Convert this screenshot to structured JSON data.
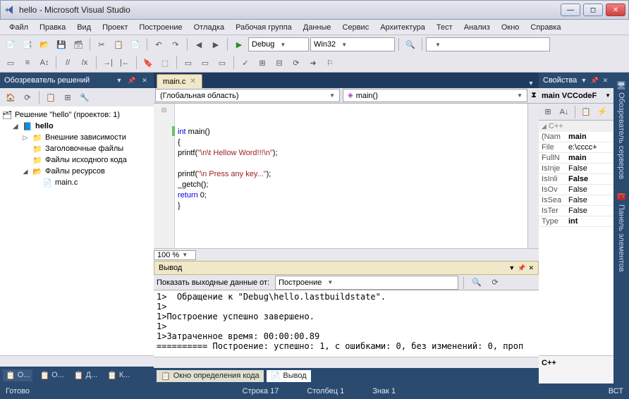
{
  "window": {
    "title": "hello - Microsoft Visual Studio"
  },
  "menu": [
    "Файл",
    "Правка",
    "Вид",
    "Проект",
    "Построение",
    "Отладка",
    "Рабочая группа",
    "Данные",
    "Сервис",
    "Архитектура",
    "Тест",
    "Анализ",
    "Окно",
    "Справка"
  ],
  "toolbar1": {
    "config": "Debug",
    "platform": "Win32"
  },
  "solution": {
    "panel_title": "Обозреватель решений",
    "root": "Решение \"hello\" (проектов: 1)",
    "project": "hello",
    "folders": {
      "external": "Внешние зависимости",
      "headers": "Заголовочные файлы",
      "sources": "Файлы исходного кода",
      "resources": "Файлы ресурсов"
    },
    "file": "main.c",
    "bottom_tabs": [
      "О...",
      "О...",
      "Д...",
      "К..."
    ]
  },
  "editor": {
    "tab": "main.c",
    "scope_left": "(Глобальная область)",
    "scope_right": "main()",
    "code": {
      "l1a": "int",
      "l1b": " main()",
      "l2": "{",
      "l3a": "printf(",
      "l3b": "\"\\n\\t Hellow Word!!!\\n\"",
      "l3c": ");",
      "l4": "",
      "l5a": "printf(",
      "l5b": "\"\\n Press any key...\"",
      "l5c": ");",
      "l6": "_getch();",
      "l7a": "return",
      "l7b": " 0;",
      "l8": "}"
    },
    "zoom": "100 %"
  },
  "output": {
    "title": "Вывод",
    "show_label": "Показать выходные данные от:",
    "source": "Построение",
    "lines": [
      "1>  Обращение к \"Debug\\hello.lastbuildstate\".",
      "1>",
      "1>Построение успешно завершено.",
      "1>",
      "1>Затраченное время: 00:00:00.89",
      "========== Построение: успешно: 1, с ошибками: 0, без изменений: 0, проп"
    ],
    "tabs": {
      "code_def": "Окно определения кода",
      "output": "Вывод"
    }
  },
  "properties": {
    "title": "Свойства",
    "object": "main VCCodeF",
    "category": "C++",
    "rows": [
      {
        "name": "(Nam",
        "val": "main",
        "bold": true
      },
      {
        "name": "File",
        "val": "e:\\cccc+",
        "bold": false
      },
      {
        "name": "FullN",
        "val": "main",
        "bold": true
      },
      {
        "name": "IsInje",
        "val": "False",
        "bold": false
      },
      {
        "name": "IsInli",
        "val": "False",
        "bold": true
      },
      {
        "name": "IsOv",
        "val": "False",
        "bold": false
      },
      {
        "name": "IsSea",
        "val": "False",
        "bold": false
      },
      {
        "name": "IsTer",
        "val": "False",
        "bold": false
      },
      {
        "name": "Type",
        "val": "int",
        "bold": true
      }
    ],
    "footer": "C++"
  },
  "right_tabs": [
    "Обозреватель серверов",
    "Панель элементов"
  ],
  "status": {
    "ready": "Готово",
    "line": "Строка 17",
    "col": "Столбец 1",
    "char": "Знак 1",
    "ins": "ВСТ"
  }
}
